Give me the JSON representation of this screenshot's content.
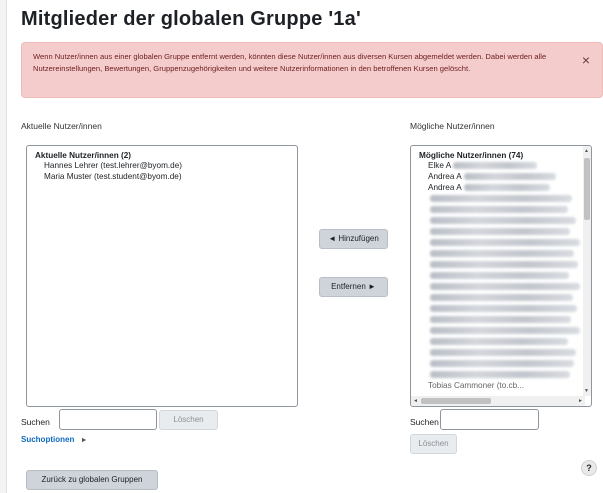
{
  "page": {
    "title": "Mitglieder der globalen Gruppe '1a'",
    "alert_text": "Wenn Nutzer/innen aus einer globalen Gruppe entfernt werden, könnten diese Nutzer/innen aus diversen Kursen abgemeldet werden. Dabei werden alle Nutzereinstellungen, Bewertungen, Gruppenzugehörigkeiten und weitere Nutzerinformationen in den betroffenen Kursen gelöscht.",
    "alert_close": "×"
  },
  "current": {
    "label": "Aktuelle Nutzer/innen",
    "group_header": "Aktuelle Nutzer/innen (2)",
    "users": [
      "Hannes Lehrer (test.lehrer@byom.de)",
      "Maria Muster (test.student@byom.de)"
    ],
    "search_label": "Suchen",
    "search_value": "",
    "clear_button": "Löschen",
    "search_options_link": "Suchoptionen",
    "search_options_icon": "caret-right-icon"
  },
  "actions": {
    "add_button": "◄ Hinzufügen",
    "remove_button": "Entfernen ►"
  },
  "potential": {
    "label": "Mögliche Nutzer/innen",
    "group_header": "Mögliche Nutzer/innen (74)",
    "visible_names": [
      "Elke A",
      "Andrea A",
      "Andrea A"
    ],
    "last_visible": "Tobias Cammoner (to.cb...",
    "search_label": "Suchen",
    "search_value": "",
    "clear_button": "Löschen"
  },
  "footer": {
    "back_button": "Zurück zu globalen Gruppen",
    "help": "?"
  }
}
